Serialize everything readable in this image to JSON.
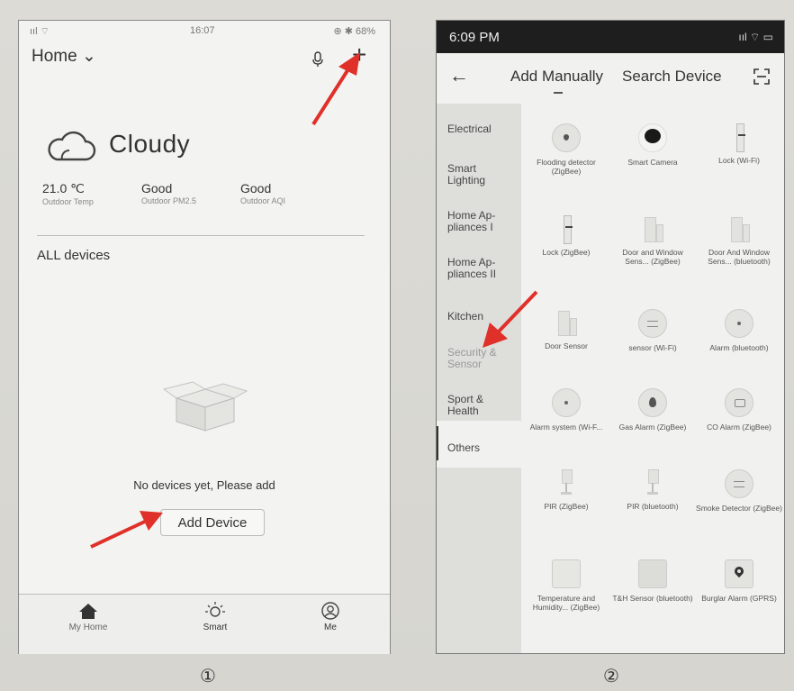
{
  "screen1": {
    "status": {
      "signal": "ııl  ⌔",
      "time": "16:07",
      "battery": "⊕ ✱ 68%"
    },
    "home_selector": "Home ⌄",
    "add_symbol": "+",
    "weather": "Cloudy",
    "stats": [
      {
        "value": "21.0 ℃",
        "label": "Outdoor Temp"
      },
      {
        "value": "Good",
        "label": "Outdoor PM2.5"
      },
      {
        "value": "Good",
        "label": "Outdoor AQI"
      }
    ],
    "section_title": "ALL devices",
    "empty_message": "No devices yet, Please add",
    "add_device_label": "Add Device",
    "tabs": [
      {
        "label": "My Home",
        "icon": "home-icon"
      },
      {
        "label": "Smart",
        "icon": "sun-icon"
      },
      {
        "label": "Me",
        "icon": "user-icon"
      }
    ],
    "figure_label": "①"
  },
  "screen2": {
    "status": {
      "time": "6:09 PM",
      "icons": "ııl ⌔ ▭"
    },
    "back_symbol": "←",
    "tab_active": "Add Manually",
    "tab_other": "Search Device",
    "categories": [
      "Electrical",
      "Smart Lighting",
      "Home Ap-pliances I",
      "Home Ap-pliances II",
      "Kitchen",
      "Security & Sensor",
      "Sport & Health",
      "Others"
    ],
    "devices": [
      "Flooding detector (ZigBee)",
      "Smart Camera",
      "Lock (Wi-Fi)",
      "Lock (ZigBee)",
      "Door and Window Sens... (ZigBee)",
      "Door And Window Sens... (bluetooth)",
      "Door Sensor",
      "sensor (Wi-Fi)",
      "Alarm (bluetooth)",
      "Alarm system (Wi-F...",
      "Gas Alarm (ZigBee)",
      "CO Alarm (ZigBee)",
      "PIR (ZigBee)",
      "PIR (bluetooth)",
      "Smoke Detector (ZigBee)",
      "Temperature and Humidity... (ZigBee)",
      "T&H Sensor (bluetooth)",
      "Burglar Alarm (GPRS)"
    ],
    "figure_label": "②"
  },
  "colors": {
    "arrow": "#e0302a",
    "status_bar": "#1e1e1e",
    "sidebar": "#dededb"
  }
}
